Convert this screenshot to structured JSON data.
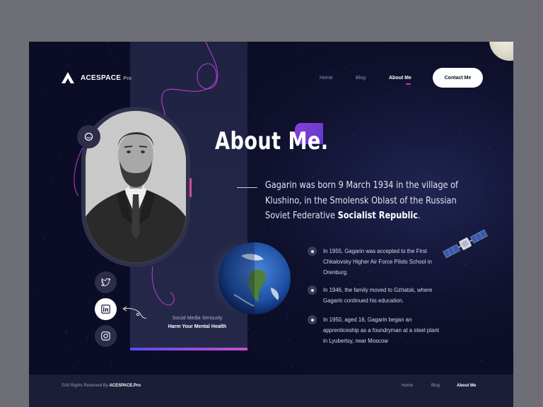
{
  "brand": {
    "name": "ACESPACE",
    "suffix": "Pro"
  },
  "nav": {
    "items": [
      {
        "label": "Home"
      },
      {
        "label": "Blog"
      },
      {
        "label": "About Me"
      }
    ],
    "active": "About Me",
    "contact_label": "Contact Me"
  },
  "hero": {
    "title": "About Me.",
    "intro_plain": "Gagarin was born 9 March 1934 in the village of Klushino, in the Smolensk Oblast of the Russian Soviet Federative",
    "intro_bold": "Socialist Republic",
    "intro_end": "."
  },
  "facts": [
    {
      "text": "In 1955, Gagarin was accepted to the First Chkalovsky Higher Air Force Pilots School in Orenburg."
    },
    {
      "text": "In 1946, the family moved to Gzhatsk, where Gagarin continued his education."
    },
    {
      "text": "In 1950, aged 16, Gagarin began an apprenticeship as a foundryman at a steel plant in Lyubertsy, near Moscow"
    }
  ],
  "social": {
    "caption_line1": "Social Media Seriously",
    "caption_line2": "Harm Your Mental Health",
    "icons": [
      "twitter-icon",
      "linkedin-icon",
      "instagram-icon"
    ],
    "active": "linkedin-icon"
  },
  "footer": {
    "copyright_prefix": "©All Rights Reserved By",
    "copyright_brand": "ACESPACE.Pro",
    "links": [
      {
        "label": "Home"
      },
      {
        "label": "Blog"
      },
      {
        "label": "About Me"
      }
    ]
  },
  "colors": {
    "background": "#0b0d26",
    "accent_purple": "#7a3fd4",
    "accent_pink": "#d24a9a",
    "button_bg": "#ffffff"
  }
}
